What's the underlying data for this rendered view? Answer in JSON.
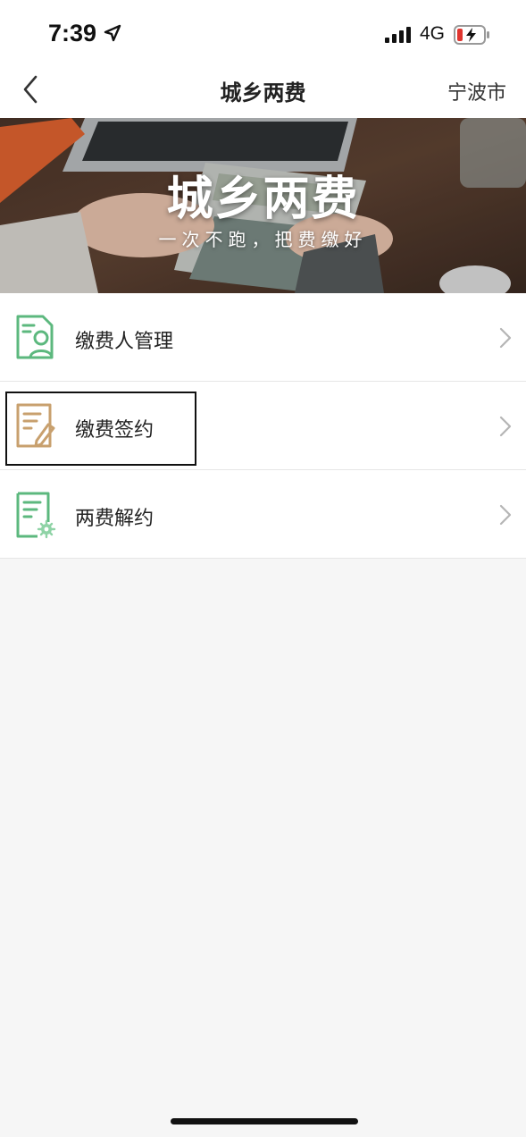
{
  "status_bar": {
    "time": "7:39",
    "network": "4G",
    "icons": [
      "location-arrow-icon",
      "signal-icon",
      "battery-charging-icon"
    ]
  },
  "nav": {
    "back_icon": "chevron-left-icon",
    "title": "城乡两费",
    "city": "宁波市"
  },
  "banner": {
    "title": "城乡两费",
    "subtitle": "一次不跑，把费缴好"
  },
  "menu": {
    "items": [
      {
        "label": "缴费人管理",
        "icon": "payer-profile-icon",
        "icon_color": "#5cb87e"
      },
      {
        "label": "缴费签约",
        "icon": "sign-contract-icon",
        "icon_color": "#c8a06e"
      },
      {
        "label": "两费解约",
        "icon": "document-settings-icon",
        "icon_color": "#5cb87e"
      }
    ],
    "chevron_icon": "chevron-right-icon"
  },
  "colors": {
    "accent_green": "#5cb87e",
    "accent_tan": "#c8a06e",
    "background": "#f6f6f6"
  }
}
